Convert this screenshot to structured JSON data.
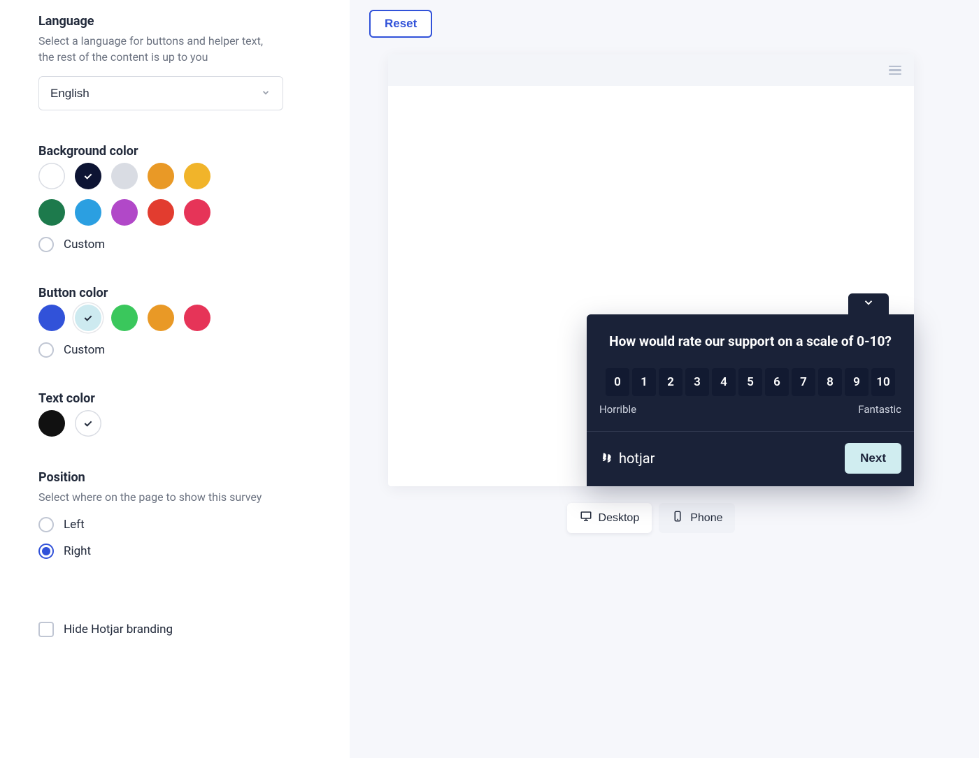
{
  "language": {
    "heading": "Language",
    "description": "Select a language for buttons and helper text, the rest of the content is up to you",
    "selected": "English"
  },
  "background": {
    "heading": "Background color",
    "custom_label": "Custom",
    "swatches": [
      {
        "color": "#ffffff",
        "outline": true
      },
      {
        "color": "#0d1433",
        "selected": true,
        "check": "dark"
      },
      {
        "color": "#d9dce3"
      },
      {
        "color": "#e99926"
      },
      {
        "color": "#f1b42a"
      },
      {
        "color": "#1d7a4c"
      },
      {
        "color": "#2b9fe1"
      },
      {
        "color": "#b148c8"
      },
      {
        "color": "#e23c2f"
      },
      {
        "color": "#e63458"
      }
    ]
  },
  "button_color": {
    "heading": "Button color",
    "custom_label": "Custom",
    "swatches": [
      {
        "color": "#3152d9"
      },
      {
        "color": "#cdeaf0",
        "selected": true,
        "check": "light",
        "ring": true
      },
      {
        "color": "#3ac75c"
      },
      {
        "color": "#e99926"
      },
      {
        "color": "#e63458"
      }
    ]
  },
  "text_color": {
    "heading": "Text color",
    "swatches": [
      {
        "color": "#111111"
      },
      {
        "color": "#ffffff",
        "outline": true,
        "selected": true,
        "check": "light"
      }
    ]
  },
  "position": {
    "heading": "Position",
    "description": "Select where on the page to show this survey",
    "options": [
      {
        "label": "Left",
        "checked": false
      },
      {
        "label": "Right",
        "checked": true
      }
    ]
  },
  "hide_branding_label": "Hide Hotjar branding",
  "reset_label": "Reset",
  "survey": {
    "question": "How would rate our support on a scale of 0-10?",
    "scale": [
      "0",
      "1",
      "2",
      "3",
      "4",
      "5",
      "6",
      "7",
      "8",
      "9",
      "10"
    ],
    "low_label": "Horrible",
    "high_label": "Fantastic",
    "brand": "hotjar",
    "next_label": "Next"
  },
  "devices": {
    "desktop": "Desktop",
    "phone": "Phone"
  }
}
